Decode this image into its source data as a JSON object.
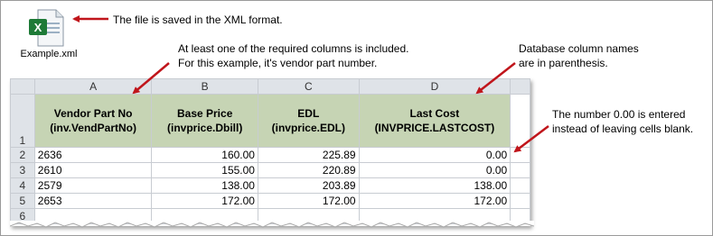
{
  "file": {
    "icon": "excel-xml-file-icon",
    "name": "Example.xml"
  },
  "callouts": {
    "format": "The file is saved in the XML format.",
    "required_line1": "At least one of the required columns is included.",
    "required_line2": "For this example, it's vendor part number.",
    "db_line1": "Database column names",
    "db_line2": "are in parenthesis.",
    "zero_line1": "The number 0.00 is entered",
    "zero_line2": "instead of leaving cells blank."
  },
  "colors": {
    "arrow": "#c0151b",
    "header_fill": "#c6d4b4",
    "grid_header": "#dfe3e8"
  },
  "sheet": {
    "col_letters": [
      "A",
      "B",
      "C",
      "D"
    ],
    "row_numbers": [
      "1",
      "2",
      "3",
      "4",
      "5",
      "6"
    ],
    "headers": [
      {
        "line1": "Vendor Part No",
        "line2": "(inv.VendPartNo)"
      },
      {
        "line1": "Base Price",
        "line2": "(invprice.Dbill)"
      },
      {
        "line1": "EDL",
        "line2": "(invprice.EDL)"
      },
      {
        "line1": "Last Cost",
        "line2": "(INVPRICE.LASTCOST)"
      }
    ],
    "rows": [
      {
        "part": "2636",
        "base": "160.00",
        "edl": "225.89",
        "last": "0.00"
      },
      {
        "part": "2610",
        "base": "155.00",
        "edl": "220.89",
        "last": "0.00"
      },
      {
        "part": "2579",
        "base": "138.00",
        "edl": "203.89",
        "last": "138.00"
      },
      {
        "part": "2653",
        "base": "172.00",
        "edl": "172.00",
        "last": "172.00"
      }
    ]
  }
}
